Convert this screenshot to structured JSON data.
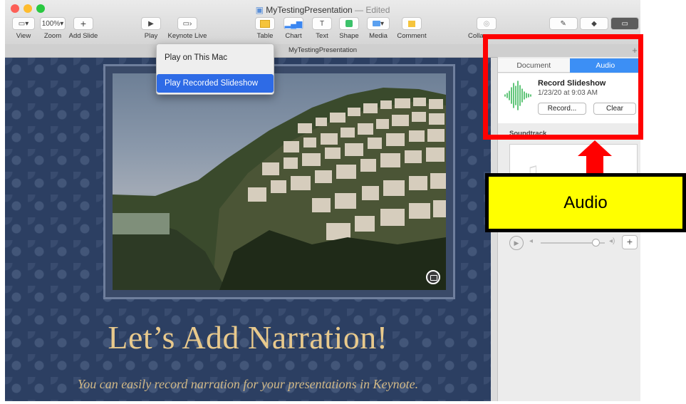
{
  "window": {
    "title": "MyTestingPresentation",
    "title_suffix": "— Edited",
    "document_tab": "MyTestingPresentation"
  },
  "toolbar": {
    "view": {
      "label": "View"
    },
    "zoom": {
      "label": "Zoom",
      "value": "100%"
    },
    "add_slide": {
      "label": "Add Slide"
    },
    "play": {
      "label": "Play"
    },
    "keynote_live": {
      "label": "Keynote Live"
    },
    "table": {
      "label": "Table"
    },
    "chart": {
      "label": "Chart"
    },
    "text": {
      "label": "Text"
    },
    "shape": {
      "label": "Shape"
    },
    "media": {
      "label": "Media"
    },
    "comment": {
      "label": "Comment"
    },
    "collaborate": {
      "label": "Colla"
    }
  },
  "play_menu": {
    "items": [
      {
        "label": "Play on This Mac",
        "selected": false
      },
      {
        "label": "Play Recorded Slideshow",
        "selected": true
      }
    ]
  },
  "slide": {
    "title": "Let’s Add Narration!",
    "subtitle": "You can easily record narration for your presentations in Keynote."
  },
  "inspector": {
    "tabs": [
      {
        "label": "Document",
        "active": false
      },
      {
        "label": "Audio",
        "active": true
      }
    ],
    "recording": {
      "title": "Record Slideshow",
      "date": "1/23/20 at 9:03 AM",
      "record_button": "Record...",
      "clear_button": "Clear"
    },
    "soundtrack_label": "Soundtrack",
    "volume_level": 0.85
  },
  "annotation": {
    "label": "Audio",
    "box_color": "#ff0000",
    "callout_color": "#ffff00"
  },
  "colors": {
    "accent": "#2e6be6",
    "segment_active": "#3c8ff5",
    "slide_title": "#e8c98c",
    "slide_background": "#2c3f62",
    "waveform": "#3cb85a"
  }
}
